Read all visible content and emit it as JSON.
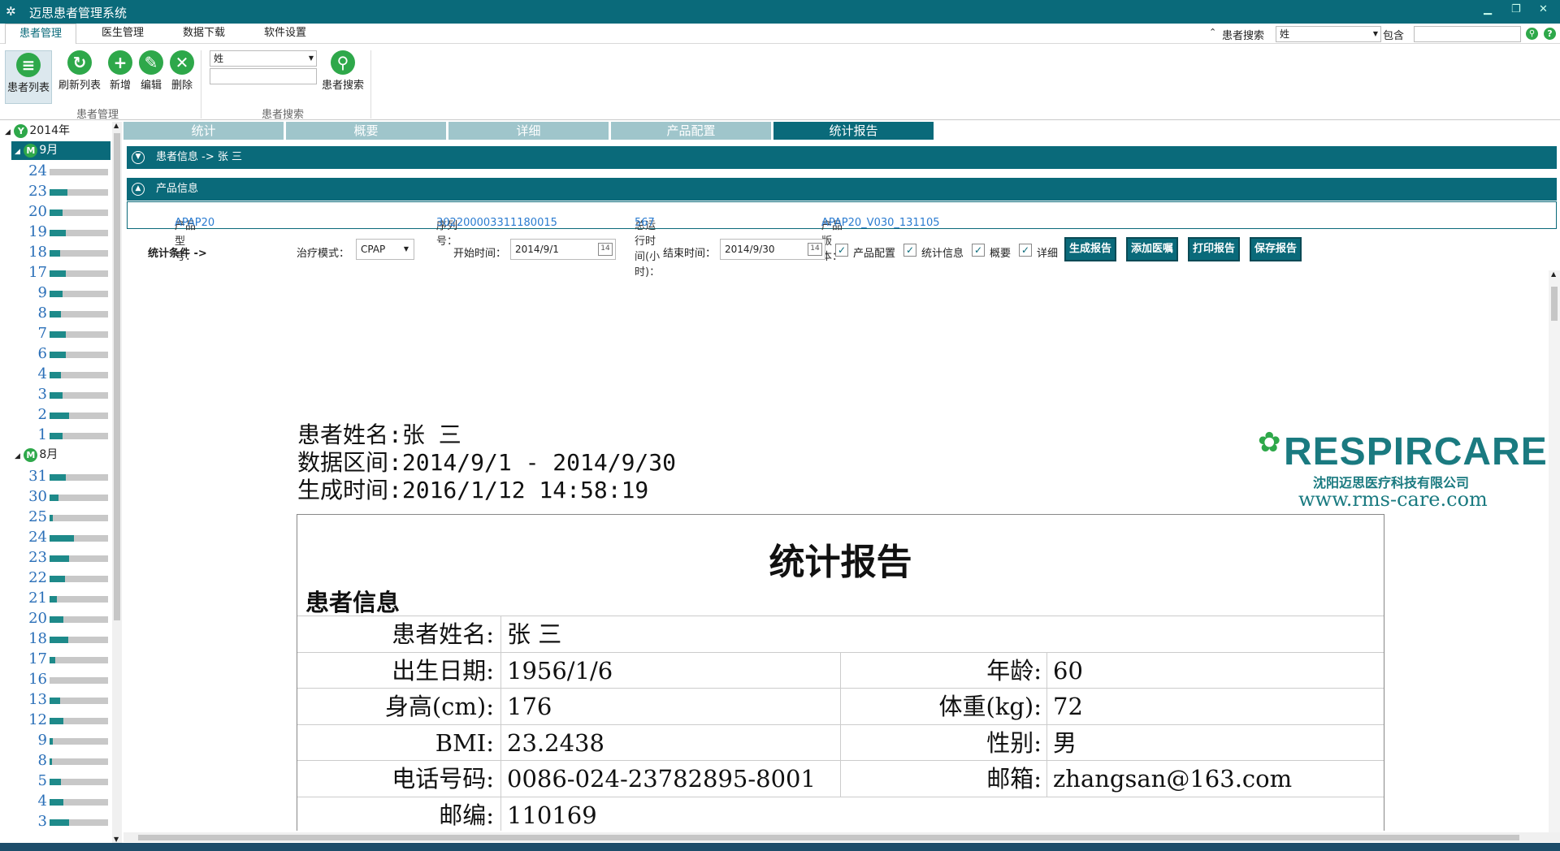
{
  "window": {
    "title": "迈思患者管理系统"
  },
  "menu": {
    "tabs": [
      "患者管理",
      "医生管理",
      "数据下载",
      "软件设置"
    ],
    "search_label": "患者搜索",
    "search_field": "姓",
    "contains_label": "包含",
    "search_value": ""
  },
  "ribbon": {
    "buttons": {
      "list": "患者列表",
      "refresh": "刷新列表",
      "add": "新增",
      "edit": "编辑",
      "delete": "删除",
      "search": "患者搜索"
    },
    "group_manage": "患者管理",
    "group_search": "患者搜索",
    "field_combo": "姓",
    "field_value": ""
  },
  "tree": {
    "year": "2014年",
    "year_badge": "Y",
    "month_badge": "M",
    "months": [
      {
        "label": "9月",
        "days": [
          {
            "d": "24",
            "level": 0.0
          },
          {
            "d": "23",
            "level": 0.3
          },
          {
            "d": "20",
            "level": 0.22
          },
          {
            "d": "19",
            "level": 0.28
          },
          {
            "d": "18",
            "level": 0.18
          },
          {
            "d": "17",
            "level": 0.28
          },
          {
            "d": "9",
            "level": 0.22
          },
          {
            "d": "8",
            "level": 0.2
          },
          {
            "d": "7",
            "level": 0.28
          },
          {
            "d": "6",
            "level": 0.28
          },
          {
            "d": "4",
            "level": 0.2
          },
          {
            "d": "3",
            "level": 0.22
          },
          {
            "d": "2",
            "level": 0.34
          },
          {
            "d": "1",
            "level": 0.22
          }
        ]
      },
      {
        "label": "8月",
        "days": [
          {
            "d": "31",
            "level": 0.28
          },
          {
            "d": "30",
            "level": 0.15
          },
          {
            "d": "25",
            "level": 0.05
          },
          {
            "d": "24",
            "level": 0.42
          },
          {
            "d": "23",
            "level": 0.34
          },
          {
            "d": "22",
            "level": 0.26
          },
          {
            "d": "21",
            "level": 0.12
          },
          {
            "d": "20",
            "level": 0.24
          },
          {
            "d": "18",
            "level": 0.32
          },
          {
            "d": "17",
            "level": 0.1
          },
          {
            "d": "16",
            "level": 0.0
          },
          {
            "d": "13",
            "level": 0.18
          },
          {
            "d": "12",
            "level": 0.24
          },
          {
            "d": "9",
            "level": 0.05
          },
          {
            "d": "8",
            "level": 0.04
          },
          {
            "d": "5",
            "level": 0.2
          },
          {
            "d": "4",
            "level": 0.24
          },
          {
            "d": "3",
            "level": 0.34
          }
        ]
      }
    ]
  },
  "tabs": [
    "统计",
    "概要",
    "详细",
    "产品配置",
    "统计报告"
  ],
  "patient_panel": {
    "title": "患者信息 -> 张 三"
  },
  "product_panel": {
    "title": "产品信息"
  },
  "product": {
    "model_label": "产品型号：",
    "model": "APAP20",
    "serial_label": "序列号：",
    "serial": "302200003311180015",
    "hours_label": "总运行时间(小时)：",
    "hours": "567",
    "version_label": "产品版本：",
    "version": "APAP20_V030_131105"
  },
  "conditions": {
    "label": "统计条件 ->",
    "mode_label": "治疗模式：",
    "mode": "CPAP",
    "start_label": "开始时间：",
    "start": "2014/9/1",
    "end_label": "结束时间：",
    "end": "2014/9/30",
    "cal_icon_text": "14",
    "checks": [
      "产品配置",
      "统计信息",
      "概要",
      "详细"
    ],
    "buttons": [
      "生成报告",
      "添加医嘱",
      "打印报告",
      "保存报告"
    ]
  },
  "report": {
    "head1": "患者姓名:张 三",
    "head2": "数据区间:2014/9/1 - 2014/9/30",
    "head3": "生成时间:2016/1/12 14:58:19",
    "brand": "RESPIRCARE",
    "brand_sub": "沈阳迈思医疗科技有限公司",
    "brand_url": "www.rms-care.com",
    "title": "统计报告",
    "section": "患者信息",
    "rows": [
      {
        "l1": "患者姓名:",
        "v1": "张 三",
        "l2": "",
        "v2": ""
      },
      {
        "l1": "出生日期:",
        "v1": "1956/1/6",
        "l2": "年龄:",
        "v2": "60"
      },
      {
        "l1": "身高(cm):",
        "v1": "176",
        "l2": "体重(kg):",
        "v2": "72"
      },
      {
        "l1": "BMI:",
        "v1": "23.2438",
        "l2": "性别:",
        "v2": "男"
      },
      {
        "l1": "电话号码:",
        "v1": "0086-024-23782895-8001",
        "l2": "邮箱:",
        "v2": "zhangsan@163.com"
      },
      {
        "l1": "邮编:",
        "v1": "110169",
        "l2": "",
        "v2": ""
      }
    ]
  },
  "colors": {
    "accent": "#0a6a7a",
    "green": "#2ea84a",
    "tab_inactive": "#9fc5cb",
    "link": "#2a7bd0"
  }
}
